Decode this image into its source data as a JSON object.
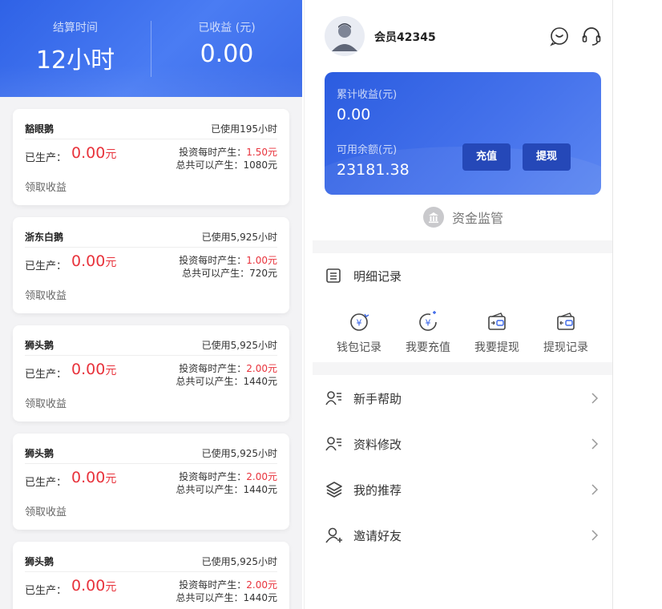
{
  "left": {
    "stats": [
      {
        "label": "结算时间",
        "value": "12小时"
      },
      {
        "label": "已收益 (元)",
        "value": "0.00"
      }
    ],
    "common": {
      "produced_label": "已生产：",
      "unit": "元",
      "rate_prefix": "投资每时产生：",
      "total_prefix": "总共可以产生：",
      "claim_label": "领取收益"
    },
    "cards": [
      {
        "name": "豁眼鹅",
        "used": "已使用195小时",
        "produced": "0.00",
        "rate": "1.50元",
        "total": "1080元"
      },
      {
        "name": "浙东白鹅",
        "used": "已使用5,925小时",
        "produced": "0.00",
        "rate": "1.00元",
        "total": "720元"
      },
      {
        "name": "狮头鹅",
        "used": "已使用5,925小时",
        "produced": "0.00",
        "rate": "2.00元",
        "total": "1440元"
      },
      {
        "name": "狮头鹅",
        "used": "已使用5,925小时",
        "produced": "0.00",
        "rate": "2.00元",
        "total": "1440元"
      },
      {
        "name": "狮头鹅",
        "used": "已使用5,925小时",
        "produced": "0.00",
        "rate": "2.00元",
        "total": "1440元"
      }
    ]
  },
  "right": {
    "username": "会员42345",
    "balance": {
      "total_label": "累计收益(元)",
      "total_value": "0.00",
      "available_label": "可用余额(元)",
      "available_value": "23181.38",
      "recharge_label": "充值",
      "withdraw_label": "提现"
    },
    "supervise_label": "资金监管",
    "detail_title": "明细记录",
    "shortcuts": [
      {
        "label": "钱包记录",
        "icon": "wallet-record-icon"
      },
      {
        "label": "我要充值",
        "icon": "recharge-icon"
      },
      {
        "label": "我要提现",
        "icon": "withdraw-icon"
      },
      {
        "label": "提现记录",
        "icon": "withdraw-record-icon"
      }
    ],
    "menu": [
      {
        "label": "新手帮助",
        "icon": "user-card-icon"
      },
      {
        "label": "资料修改",
        "icon": "user-card-icon"
      },
      {
        "label": "我的推荐",
        "icon": "layers-icon"
      },
      {
        "label": "邀请好友",
        "icon": "add-user-icon"
      }
    ]
  },
  "colors": {
    "primary": "#2f62e6",
    "accent_red": "#e8333c"
  }
}
